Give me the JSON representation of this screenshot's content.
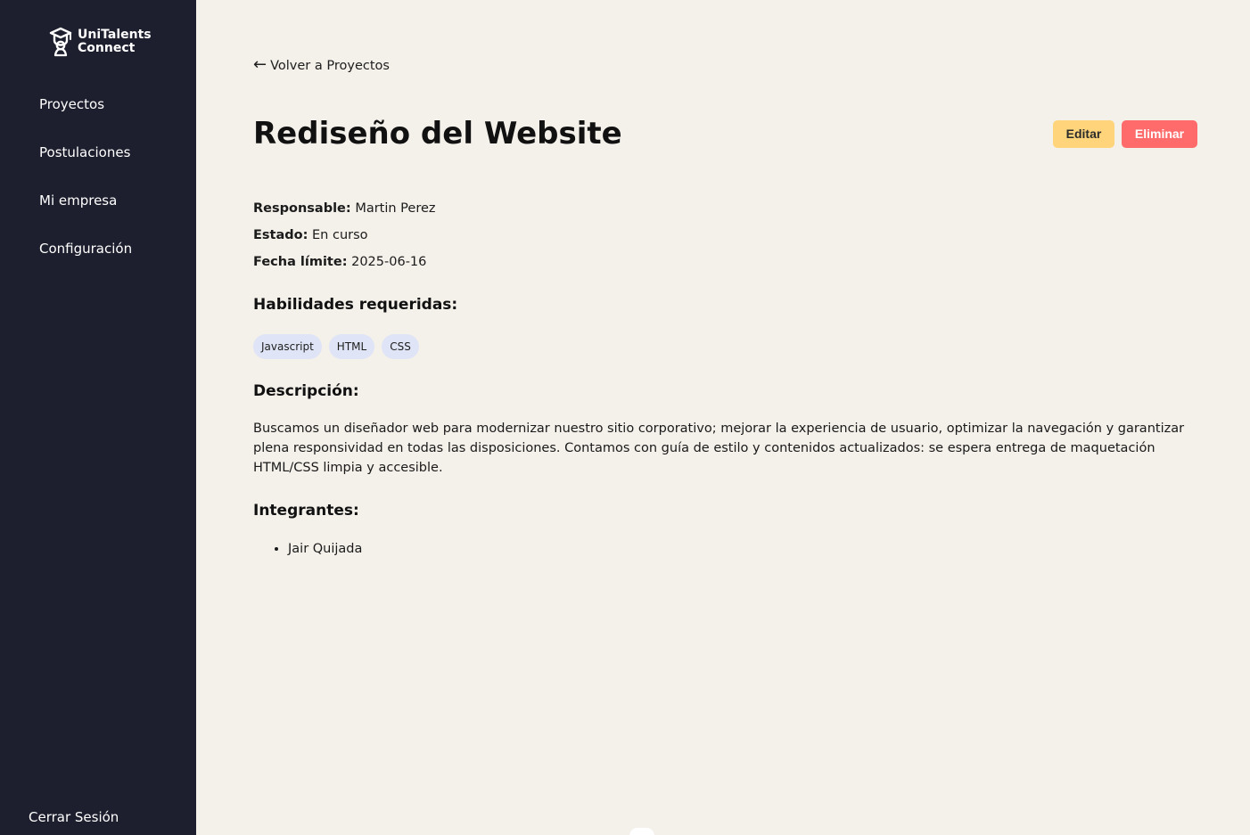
{
  "app": {
    "brand": {
      "line1": "UniTalents",
      "line2": "Connect",
      "icon": "graduation-cap-icon"
    }
  },
  "sidebar": {
    "items": [
      {
        "label": "Proyectos"
      },
      {
        "label": "Postulaciones"
      },
      {
        "label": "Mi empresa"
      },
      {
        "label": "Configuración"
      }
    ],
    "logout_label": "Cerrar Sesión"
  },
  "page": {
    "back_label": "Volver a Proyectos",
    "back_icon": "left-arrow-icon",
    "title": "Rediseño del Website",
    "actions": {
      "edit": "Editar",
      "delete": "Eliminar"
    },
    "details": {
      "responsable_label": "Responsable:",
      "responsable": "Martin Perez",
      "estado_label": "Estado:",
      "estado": "En curso",
      "fecha_label": "Fecha límite:",
      "fecha": "2025-06-16"
    },
    "skills_heading": "Habilidades requeridas:",
    "skills": [
      "Javascript",
      "HTML",
      "CSS"
    ],
    "description_heading": "Descripción:",
    "description": "Buscamos un diseñador web para modernizar nuestro sitio corporativo; mejorar la experiencia de usuario, optimizar la navegación y garantizar plena responsividad en todas las disposiciones. Contamos con guía de estilo y contenidos actualizados: se espera entrega de maquetación HTML/CSS limpia y accesible.",
    "members_heading": "Integrantes:",
    "members": [
      "Jair Quijada"
    ]
  },
  "colors": {
    "sidebar_bg": "#1d1f2e",
    "page_bg": "#f4f0ea",
    "edit_button": "#ffd47a",
    "delete_button": "#ff6b6b",
    "skill_badge": "#dfe5f6"
  }
}
